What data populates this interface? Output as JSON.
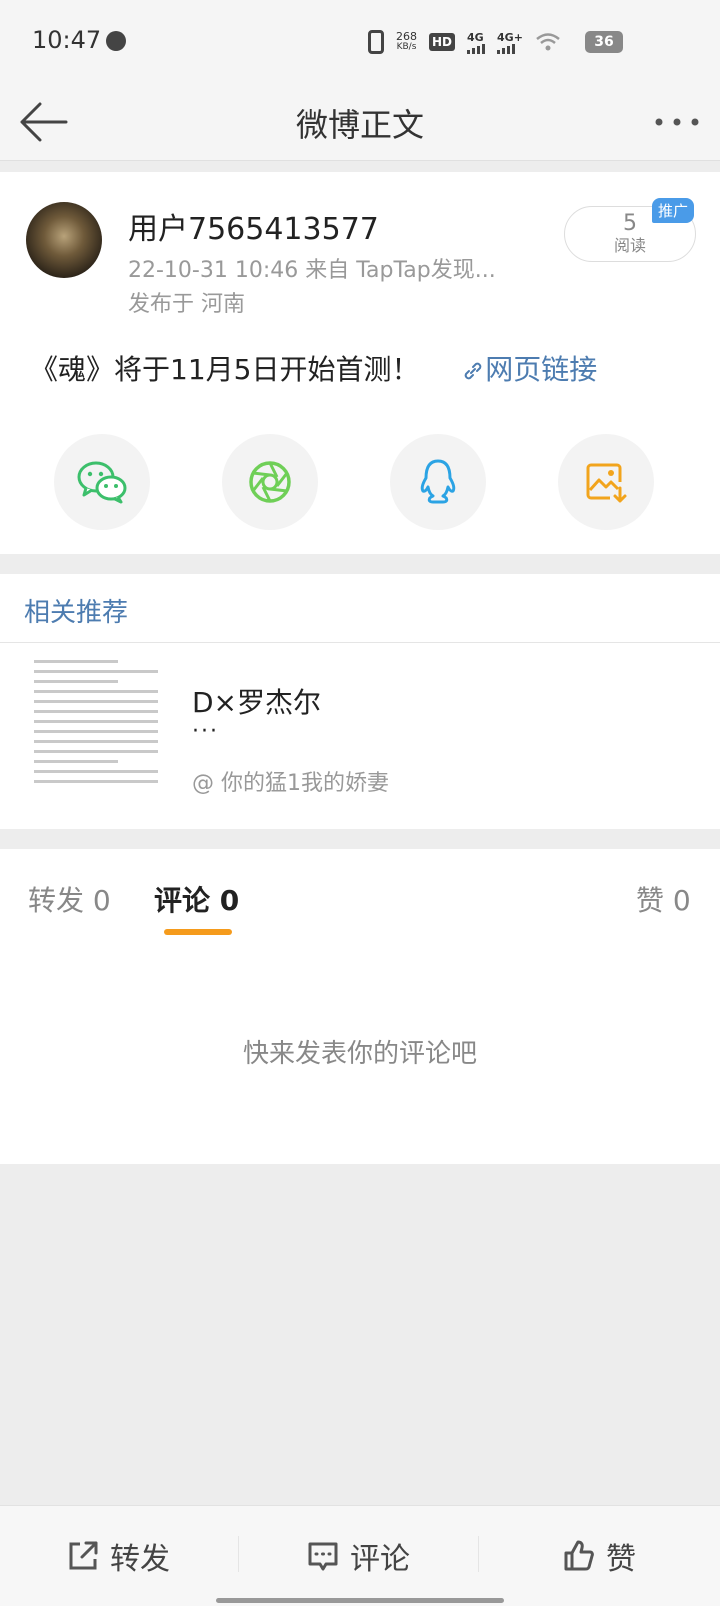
{
  "status_bar": {
    "time": "10:47",
    "net_speed_value": "268",
    "net_speed_unit": "KB/s",
    "hd_label": "HD",
    "sim1_label": "4G",
    "sim2_label": "4G+",
    "battery": "36"
  },
  "nav": {
    "title": "微博正文"
  },
  "post": {
    "username": "用户7565413577",
    "meta": "22-10-31 10:46   来自 TapTap发现...",
    "location": "发布于 河南",
    "read_count": "5",
    "read_label": "阅读",
    "promo_badge": "推广",
    "text": "《魂》将于11月5日开始首测！",
    "link_label": "网页链接"
  },
  "share_targets": [
    {
      "icon": "wechat-icon",
      "color": "#3cbf6b"
    },
    {
      "icon": "moments-icon",
      "color": "#6fcf57"
    },
    {
      "icon": "qq-icon",
      "color": "#2ba3e4"
    },
    {
      "icon": "save-image-icon",
      "color": "#f2a41c"
    }
  ],
  "recommendations": {
    "title": "相关推荐",
    "item": {
      "name": "D×罗杰尔",
      "dots": "···",
      "author": "@ 你的猛1我的娇妻"
    }
  },
  "tabs": {
    "repost": "转发 0",
    "comment": "评论 0",
    "like": "赞 0"
  },
  "comments": {
    "empty": "快来发表你的评论吧"
  },
  "bottom_bar": {
    "repost": "转发",
    "comment": "评论",
    "like": "赞"
  },
  "colors": {
    "link": "#4d7cb0",
    "accent": "#f59b1c",
    "promo": "#4a9be8"
  }
}
